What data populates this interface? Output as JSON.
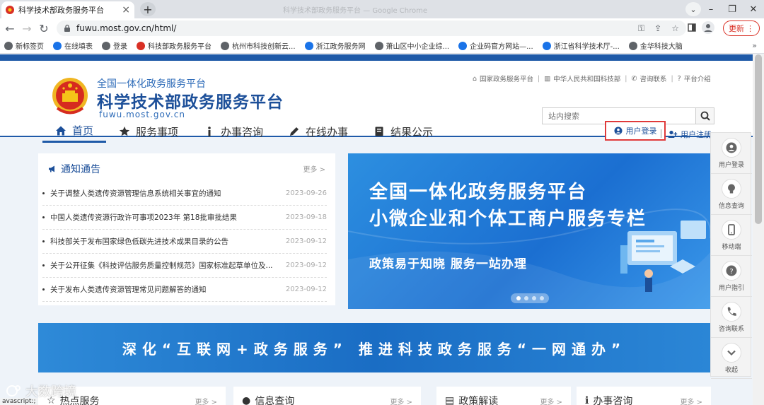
{
  "browser": {
    "tab_title": "科学技术部政务服务平台",
    "window_title": "科学技术部政务服务平台 — Google Chrome",
    "url": "fuwu.most.gov.cn/html/",
    "update_label": "更新",
    "bookmarks": [
      {
        "label": "新标签页",
        "color": "#5f6368"
      },
      {
        "label": "在线填表",
        "color": "#1a73e8"
      },
      {
        "label": "登录",
        "color": "#5f6368"
      },
      {
        "label": "科技部政务服务平台",
        "color": "#d93025"
      },
      {
        "label": "杭州市科技创新云...",
        "color": "#5f6368"
      },
      {
        "label": "浙江政务服务网",
        "color": "#1a73e8"
      },
      {
        "label": "萧山区中小企业综...",
        "color": "#5f6368"
      },
      {
        "label": "企业码官方网站—...",
        "color": "#1a73e8"
      },
      {
        "label": "浙江省科学技术厅-...",
        "color": "#1a73e8"
      },
      {
        "label": "金华科技大脑",
        "color": "#5f6368"
      }
    ]
  },
  "header": {
    "subtitle": "全国一体化政务服务平台",
    "title": "科学技术部政务服务平台",
    "domain": "fuwu.most.gov.cn",
    "top_links": [
      "国家政务服务平台",
      "中华人民共和国科技部",
      "咨询联系",
      "平台介绍"
    ],
    "search_placeholder": "站内搜索",
    "login_label": "用户登录",
    "register_label": "用户注册"
  },
  "nav": [
    {
      "label": "首页",
      "icon": "home-icon"
    },
    {
      "label": "服务事项",
      "icon": "star-icon"
    },
    {
      "label": "办事咨询",
      "icon": "info-icon"
    },
    {
      "label": "在线办事",
      "icon": "pencil-icon"
    },
    {
      "label": "结果公示",
      "icon": "book-icon"
    }
  ],
  "notice": {
    "title": "通知通告",
    "more": "更多 >",
    "items": [
      {
        "title": "关于调整人类遗传资源管理信息系统相关事宜的通知",
        "date": "2023-09-26"
      },
      {
        "title": "中国人类遗传资源行政许可事项2023年 第18批审批结果",
        "date": "2023-09-18"
      },
      {
        "title": "科技部关于发布国家绿色低碳先进技术成果目录的公告",
        "date": "2023-09-12"
      },
      {
        "title": "关于公开征集《科技评估服务质量控制规范》国家标准起草单位及...",
        "date": "2023-09-12"
      },
      {
        "title": "关于发布人类遗传资源管理常见问题解答的通知",
        "date": "2023-09-12"
      }
    ]
  },
  "banner": {
    "line1": "全国一体化政务服务平台",
    "line2": "小微企业和个体工商户服务专栏",
    "line3": "政策易于知晓 服务一站办理"
  },
  "wide_banner": {
    "text": "深化“互联网+政务服务” 推进科技政务服务“一网通办”"
  },
  "cards": [
    {
      "title": "热点服务",
      "more": "更多 >"
    },
    {
      "title": "信息查询",
      "more": "更多 >"
    },
    {
      "title": "政策解读",
      "more": "更多 >"
    },
    {
      "title": "办事咨询",
      "more": "更多 >"
    }
  ],
  "side": [
    {
      "label": "用户登录",
      "icon": "user-icon"
    },
    {
      "label": "信息查询",
      "icon": "bulb-icon"
    },
    {
      "label": "移动端",
      "icon": "mobile-icon"
    },
    {
      "label": "用户指引",
      "icon": "help-icon"
    },
    {
      "label": "咨询联系",
      "icon": "phone-icon"
    },
    {
      "label": "收起",
      "icon": "chevron-down-icon"
    }
  ],
  "status_text": "avascript:;",
  "watermark": "大数跨境"
}
